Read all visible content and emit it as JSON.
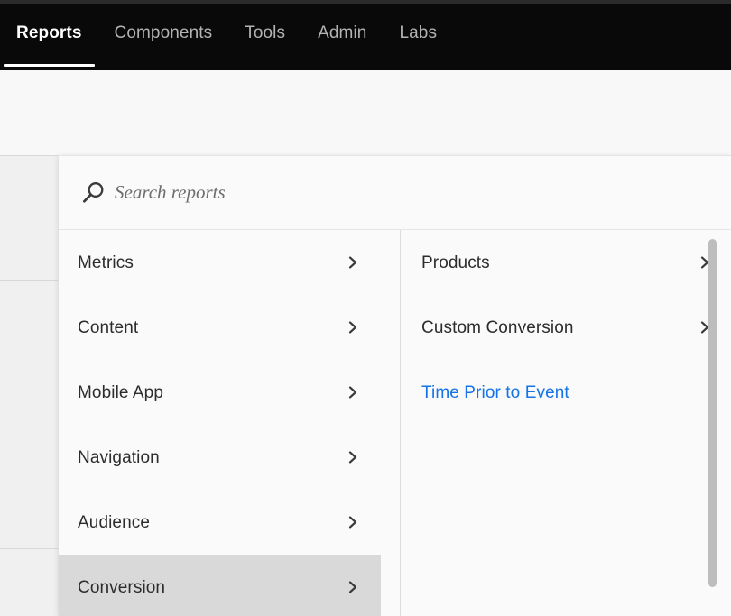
{
  "topnav": {
    "items": [
      {
        "label": "Reports",
        "active": true
      },
      {
        "label": "Components",
        "active": false
      },
      {
        "label": "Tools",
        "active": false
      },
      {
        "label": "Admin",
        "active": false
      },
      {
        "label": "Labs",
        "active": false
      }
    ]
  },
  "search": {
    "placeholder": "Search reports",
    "value": "",
    "icon": "search-icon"
  },
  "menu": {
    "left_column": [
      {
        "label": "Metrics",
        "chevron": true,
        "selected": false,
        "link": false
      },
      {
        "label": "Content",
        "chevron": true,
        "selected": false,
        "link": false
      },
      {
        "label": "Mobile App",
        "chevron": true,
        "selected": false,
        "link": false
      },
      {
        "label": "Navigation",
        "chevron": true,
        "selected": false,
        "link": false
      },
      {
        "label": "Audience",
        "chevron": true,
        "selected": false,
        "link": false
      },
      {
        "label": "Conversion",
        "chevron": true,
        "selected": true,
        "link": false
      }
    ],
    "right_column": [
      {
        "label": "Products",
        "chevron": true,
        "selected": false,
        "link": false
      },
      {
        "label": "Custom Conversion",
        "chevron": true,
        "selected": false,
        "link": false
      },
      {
        "label": "Time Prior to Event",
        "chevron": false,
        "selected": false,
        "link": true
      }
    ]
  },
  "colors": {
    "nav_bg": "#090909",
    "nav_active_text": "#ffffff",
    "nav_text": "#b3b3b3",
    "popover_bg": "#fafafa",
    "selected_row_bg": "#d9d9d9",
    "link_blue": "#1473e6",
    "text": "#2c2c2c",
    "page_bg": "#f0f0f0"
  }
}
